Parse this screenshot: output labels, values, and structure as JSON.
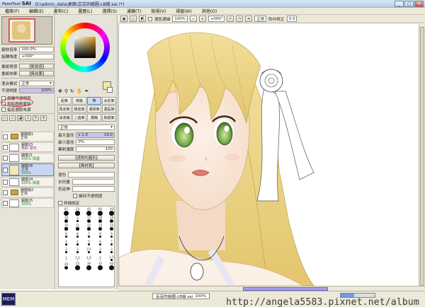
{
  "window": {
    "app_name": "SAI",
    "app_prefix": "PaintTool",
    "title": "D:\\admin_data\\桌面\\芸芸的繪圖-LB繪.sai (*)",
    "minimize": "_",
    "maximize": "□",
    "close": "×"
  },
  "menu": {
    "items": [
      "檔案(F)",
      "編輯(E)",
      "畫布(C)",
      "圖層(L)",
      "選擇(S)",
      "濾鏡(T)",
      "檢視(V)",
      "視窗(W)",
      "其他(O)"
    ]
  },
  "navigator": {
    "zoom_label": "縮放倍率",
    "zoom_value": "100.0%",
    "angle_label": "旋轉角度",
    "angle_value": "+000°"
  },
  "layer_panel": {
    "paper_texture_label": "畫紙質感",
    "paper_texture_value": "【無質感】",
    "paper_effect_label": "畫紙效果",
    "paper_effect_value": "【無效果】",
    "blend_mode_label": "混合模式",
    "blend_mode_value": "正常",
    "opacity_label": "不透明度",
    "opacity_value": "100%",
    "protect_alpha": "保護不透明度",
    "clipping_group": "剪貼圖層蒙版",
    "selection_source": "指定選取來源",
    "layers": [
      {
        "name": "圖層組1",
        "mode": "正常",
        "pct": "100%",
        "type": "folder"
      },
      {
        "name": "圖層23",
        "mode": "正常",
        "pct": "色彩 發光",
        "type": "layer"
      },
      {
        "name": "圖層21",
        "mode": "正常",
        "pct": "100% 保護",
        "type": "layer"
      },
      {
        "name": "圖層26",
        "mode": "正常",
        "pct": "100%",
        "type": "layer",
        "selected": true
      },
      {
        "name": "圖層24",
        "mode": "正常",
        "pct": "100% 保護",
        "type": "layer"
      },
      {
        "name": "圖層組2",
        "mode": "正常",
        "pct": "100%",
        "type": "folder"
      },
      {
        "name": "圖層25",
        "mode": "正常",
        "pct": "100%",
        "type": "layer"
      }
    ]
  },
  "color_panel": {
    "fg_color": "#f0e4a8",
    "bg_color": "#ffffff",
    "hue_accent": "#d79a1e"
  },
  "tools": {
    "row1": [
      "鉛筆",
      "噴槍",
      "筆",
      "水彩筆"
    ],
    "row2": [
      "馬克筆",
      "橡皮擦",
      "選擇筆",
      "選區擦"
    ],
    "row3": [
      "油漆桶",
      "二值筆",
      "模糊",
      "和紙筆"
    ],
    "active": "筆"
  },
  "brush_settings": {
    "mode_value": "正常",
    "size_label": "最大直徑",
    "size_mult": "x 1.0",
    "size_value": "19.0",
    "min_size_label": "最小直徑",
    "min_size_value": "0%",
    "density_label": "筆刷濃度",
    "density_value": "100",
    "shape_label": "【通常的圓形】",
    "texture_label": "【無材質】",
    "blend_label": "混色",
    "water_label": "水份量",
    "color_extend_label": "色延伸",
    "keep_opacity_label": "維持不透明度",
    "detail_label": "詳細設定"
  },
  "brush_sizes": [
    "87",
    "23",
    "45",
    "80",
    "40",
    "16",
    "3",
    "17",
    "18",
    "19",
    "10",
    "11",
    "12",
    "13",
    "15",
    "8",
    "8",
    "7",
    "8",
    "9",
    "4",
    "4",
    "5",
    "6",
    "7",
    "3",
    "3",
    "3.5",
    "3",
    "3",
    "1",
    "1.2",
    "1.6",
    "2",
    "2.5",
    "20",
    "25",
    "30",
    "35",
    "40"
  ],
  "canvas_toolbar": {
    "selection_label": "選區邊緣",
    "zoom_value": "100%",
    "angle_value": "+000°",
    "mode_value": "正常",
    "stabilizer_label": "防抖修正",
    "stabilizer_value": "S-3"
  },
  "status": {
    "document_tab": "芸芸的繪圖-LB繪.sai",
    "document_zoom": "100%",
    "watermark_url": "http://angela5583.pixnet.net/album",
    "cpu_label": "MEM"
  }
}
